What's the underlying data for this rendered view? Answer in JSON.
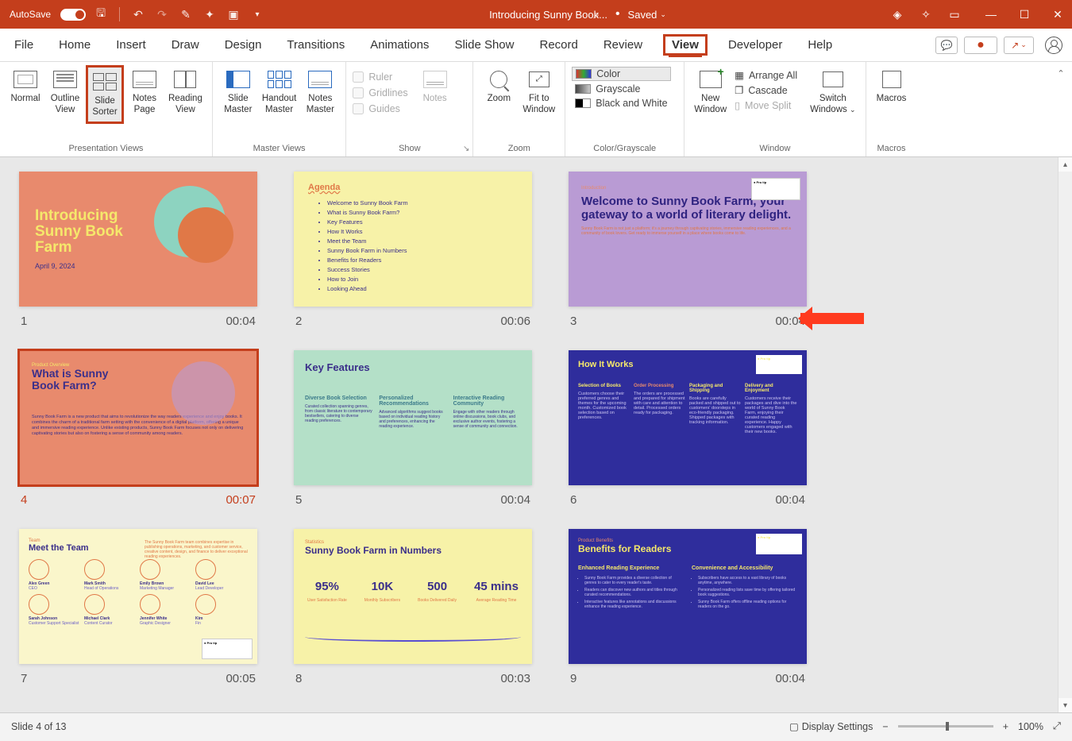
{
  "titlebar": {
    "autosave": "AutoSave",
    "autosave_state": "On",
    "filename": "Introducing Sunny Book...",
    "saved_status": "Saved"
  },
  "tabs": {
    "file": "File",
    "home": "Home",
    "insert": "Insert",
    "draw": "Draw",
    "design": "Design",
    "transitions": "Transitions",
    "animations": "Animations",
    "slideshow": "Slide Show",
    "record": "Record",
    "review": "Review",
    "view": "View",
    "developer": "Developer",
    "help": "Help"
  },
  "ribbon": {
    "presentation_views": {
      "label": "Presentation Views",
      "normal": "Normal",
      "outline": "Outline\nView",
      "sorter": "Slide\nSorter",
      "notes": "Notes\nPage",
      "reading": "Reading\nView"
    },
    "master_views": {
      "label": "Master Views",
      "slide_master": "Slide\nMaster",
      "handout_master": "Handout\nMaster",
      "notes_master": "Notes\nMaster"
    },
    "show": {
      "label": "Show",
      "ruler": "Ruler",
      "gridlines": "Gridlines",
      "guides": "Guides",
      "notes": "Notes"
    },
    "zoom": {
      "label": "Zoom",
      "zoom": "Zoom",
      "fit": "Fit to\nWindow"
    },
    "color": {
      "label": "Color/Grayscale",
      "color": "Color",
      "grayscale": "Grayscale",
      "bw": "Black and White"
    },
    "window": {
      "label": "Window",
      "new": "New\nWindow",
      "arrange": "Arrange All",
      "cascade": "Cascade",
      "move_split": "Move Split",
      "switch": "Switch\nWindows"
    },
    "macros": {
      "label": "Macros",
      "macros": "Macros"
    }
  },
  "slides": [
    {
      "num": "1",
      "time": "00:04",
      "title": "Introducing Sunny Book Farm",
      "date": "April 9, 2024"
    },
    {
      "num": "2",
      "time": "00:06",
      "title": "Agenda",
      "items": [
        "Welcome to Sunny Book Farm",
        "What is Sunny Book Farm?",
        "Key Features",
        "How It Works",
        "Meet the Team",
        "Sunny Book Farm in Numbers",
        "Benefits for Readers",
        "Success Stories",
        "How to Join",
        "Looking Ahead"
      ]
    },
    {
      "num": "3",
      "time": "00:04",
      "title": "Welcome to Sunny Book Farm, your gateway to a world of literary delight.",
      "body": "Sunny Book Farm is not just a platform; it's a journey through captivating stories, immersive reading experiences, and a community of book lovers. Get ready to immerse yourself in a place where books come to life."
    },
    {
      "num": "4",
      "time": "00:07",
      "title": "What is Sunny Book Farm?",
      "body": "Sunny Book Farm is a new product that aims to revolutionize the way readers experience and enjoy books. It combines the charm of a traditional farm setting with the convenience of a digital platform, offering a unique and immersive reading experience. Unlike existing products, Sunny Book Farm focuses not only on delivering captivating stories but also on fostering a sense of community among readers."
    },
    {
      "num": "5",
      "time": "00:04",
      "title": "Key Features",
      "cols": [
        {
          "h": "Diverse Book Selection",
          "p": "Curated collection spanning genres, from classic literature to contemporary bestsellers, catering to diverse reading preferences."
        },
        {
          "h": "Personalized Recommendations",
          "p": "Advanced algorithms suggest books based on individual reading history and preferences, enhancing the reading experience."
        },
        {
          "h": "Interactive Reading Community",
          "p": "Engage with other readers through online discussions, book clubs, and exclusive author events, fostering a sense of community and connection."
        }
      ]
    },
    {
      "num": "6",
      "time": "00:04",
      "title": "How It Works",
      "steps": [
        {
          "h": "Selection of Books",
          "p": "Customers choose their preferred genres and themes for the upcoming month. Customized book selection based on preferences."
        },
        {
          "h": "Order Processing",
          "p": "The orders are processed and prepared for shipment with care and attention to detail. Processed orders ready for packaging."
        },
        {
          "h": "Packaging and Shipping",
          "p": "Books are carefully packed and shipped out to customers' doorsteps in eco-friendly packaging. Shipped packages with tracking information."
        },
        {
          "h": "Delivery and Enjoyment",
          "p": "Customers receive their packages and dive into the world of Sunny Book Farm, enjoying their curated reading experience. Happy customers engaged with their new books."
        }
      ]
    },
    {
      "num": "7",
      "time": "00:05",
      "title": "Meet the Team",
      "members": [
        {
          "n": "Alex Green",
          "r": "CEO"
        },
        {
          "n": "Mark Smith",
          "r": "Head of Operations"
        },
        {
          "n": "Emily Brown",
          "r": "Marketing Manager"
        },
        {
          "n": "David Lee",
          "r": "Lead Developer"
        },
        {
          "n": "Sarah Johnson",
          "r": "Customer Support Specialist"
        },
        {
          "n": "Michael Clark",
          "r": "Content Curator"
        },
        {
          "n": "Jennifer White",
          "r": "Graphic Designer"
        },
        {
          "n": "Kim",
          "r": "Fin"
        }
      ],
      "sidetext": "The Sunny Book Farm team combines expertise in publishing operations, marketing, and customer service, creative content, design, and finance to deliver exceptional reading experiences."
    },
    {
      "num": "8",
      "time": "00:03",
      "title": "Sunny Book Farm in Numbers",
      "stats": [
        {
          "n": "95%",
          "l": "User Satisfaction Rate"
        },
        {
          "n": "10K",
          "l": "Monthly Subscribers"
        },
        {
          "n": "500",
          "l": "Books Delivered Daily"
        },
        {
          "n": "45 mins",
          "l": "Average Reading Time"
        }
      ]
    },
    {
      "num": "9",
      "time": "00:04",
      "title": "Benefits for Readers",
      "cols": [
        {
          "h": "Enhanced Reading Experience",
          "items": [
            "Sunny Book Farm provides a diverse collection of genres to cater to every reader's taste.",
            "Readers can discover new authors and titles through curated recommendations.",
            "Interactive features like annotations and discussions enhance the reading experience."
          ]
        },
        {
          "h": "Convenience and Accessibility",
          "items": [
            "Subscribers have access to a vast library of books anytime, anywhere.",
            "Personalized reading lists save time by offering tailored book suggestions.",
            "Sunny Book Farm offers offline reading options for readers on the go."
          ]
        }
      ]
    }
  ],
  "statusbar": {
    "counter": "Slide 4 of 13",
    "display_settings": "Display Settings",
    "zoom": "100%"
  }
}
